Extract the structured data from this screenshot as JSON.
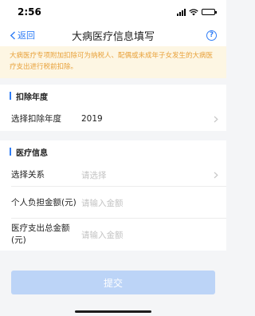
{
  "status_bar": {
    "time": "2:56"
  },
  "nav": {
    "back_label": "返回",
    "title": "大病医疗信息填写",
    "help_glyph": "?"
  },
  "notice": {
    "text": "大病医疗专项附加扣除可为纳税人、配偶或未成年子女发生的大病医疗支出进行税前扣除。"
  },
  "sections": {
    "deduction_year": {
      "title": "扣除年度",
      "year_row": {
        "label": "选择扣除年度",
        "value": "2019"
      }
    },
    "medical_info": {
      "title": "医疗信息",
      "relation_row": {
        "label": "选择关系",
        "placeholder": "请选择"
      },
      "personal_row": {
        "label": "个人负担金额(元)",
        "placeholder": "请输入金额"
      },
      "total_row": {
        "label": "医疗支出总金额(元)",
        "placeholder": "请输入金额"
      }
    }
  },
  "submit": {
    "label": "提交"
  },
  "colors": {
    "accent": "#2f7df6",
    "notice_bg": "#fdf6e3",
    "notice_text": "#e8a13a",
    "submit_disabled": "#bcd4f7"
  }
}
